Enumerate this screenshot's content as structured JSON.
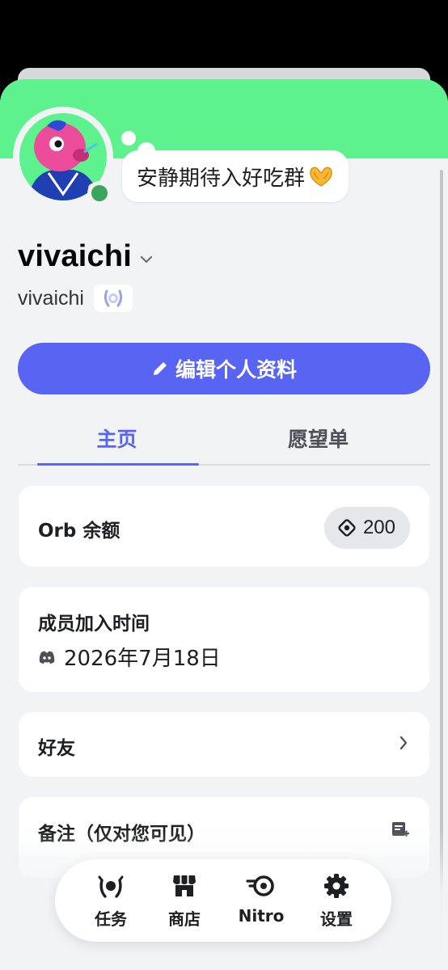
{
  "colors": {
    "banner": "#5ef28e",
    "accent": "#5865f2",
    "status_online": "#3ba55d",
    "background": "#f2f3f5",
    "card": "#ffffff"
  },
  "status_bubble": {
    "text": "安静期待入好吃群",
    "emoji": "heart-hands-emoji"
  },
  "profile": {
    "display_name": "vivaichi",
    "username": "vivaichi",
    "status": "online",
    "badge_icon": "laurel-badge-icon"
  },
  "edit_button": {
    "label": "编辑个人资料",
    "icon": "pencil-icon"
  },
  "tabs": [
    {
      "label": "主页",
      "active": true
    },
    {
      "label": "愿望单",
      "active": false
    }
  ],
  "orb": {
    "label": "Orb 余额",
    "balance": "200",
    "icon": "orb-icon"
  },
  "member_since": {
    "title": "成员加入时间",
    "date": "2026年7月18日",
    "icon": "discord-icon"
  },
  "friends": {
    "label": "好友"
  },
  "notes": {
    "label": "备注（仅对您可见）",
    "icon": "note-add-icon"
  },
  "bottom_nav": [
    {
      "label": "任务",
      "icon": "quests-icon"
    },
    {
      "label": "商店",
      "icon": "shop-icon"
    },
    {
      "label": "Nitro",
      "icon": "nitro-icon"
    },
    {
      "label": "设置",
      "icon": "settings-gear-icon"
    }
  ]
}
